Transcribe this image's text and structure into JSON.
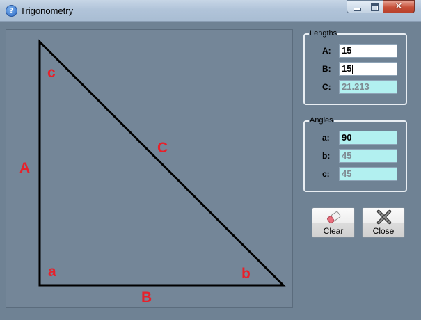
{
  "window": {
    "title": "Trigonometry",
    "app_icon_glyph": "?"
  },
  "diagram": {
    "side_labels": {
      "A": "A",
      "B": "B",
      "C": "C"
    },
    "angle_labels": {
      "a": "a",
      "b": "b",
      "c": "c"
    },
    "label_color": "#e8202a"
  },
  "lengths": {
    "legend": "Lengths",
    "rows": [
      {
        "label": "A:",
        "value": "15"
      },
      {
        "label": "B:",
        "value": "15"
      },
      {
        "label": "C:",
        "value": "21.213"
      }
    ]
  },
  "angles": {
    "legend": "Angles",
    "rows": [
      {
        "label": "a:",
        "value": "90"
      },
      {
        "label": "b:",
        "value": "45"
      },
      {
        "label": "c:",
        "value": "45"
      }
    ]
  },
  "buttons": {
    "clear": {
      "label": "Clear",
      "icon": "eraser-icon"
    },
    "close": {
      "label": "Close",
      "icon": "close-x-icon"
    }
  },
  "colors": {
    "readonly_field": "#b2f0f0",
    "canvas": "#748698",
    "form_background": "#6f8294"
  }
}
